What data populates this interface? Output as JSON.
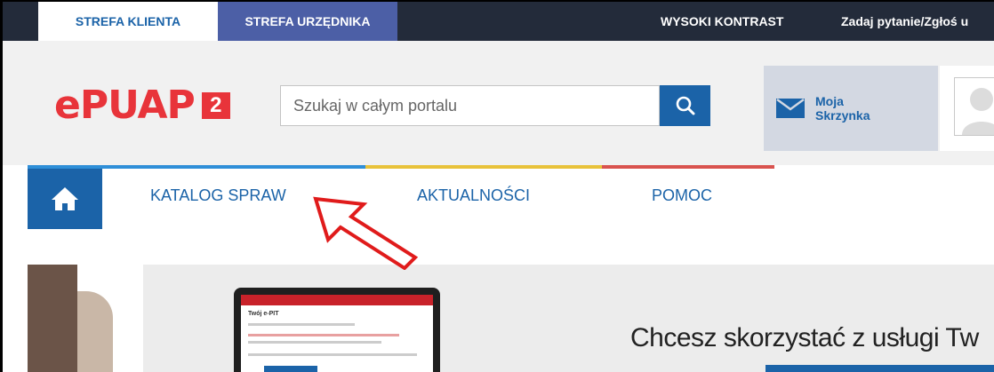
{
  "topbar": {
    "client_tab": "STREFA KLIENTA",
    "official_tab": "STREFA URZĘDNIKA",
    "high_contrast": "WYSOKI KONTRAST",
    "ask_question": "Zadaj pytanie/Zgłoś u"
  },
  "header": {
    "logo_text": "ePUAP",
    "logo_badge": "2",
    "search_placeholder": "Szukaj w całym portalu",
    "inbox_label": "Moja Skrzynka"
  },
  "nav": {
    "items": [
      {
        "label": "KATALOG SPRAW"
      },
      {
        "label": "AKTUALNOŚCI"
      },
      {
        "label": "POMOC"
      }
    ]
  },
  "hero": {
    "title": "Chcesz skorzystać z usługi Tw",
    "screen_title": "Twój e-PIT"
  },
  "colors": {
    "brand_blue": "#1b63a8",
    "brand_red": "#e8343a",
    "stripe_blue": "#2f8fd8",
    "stripe_yellow": "#e8c23a",
    "stripe_red": "#d9534f"
  }
}
